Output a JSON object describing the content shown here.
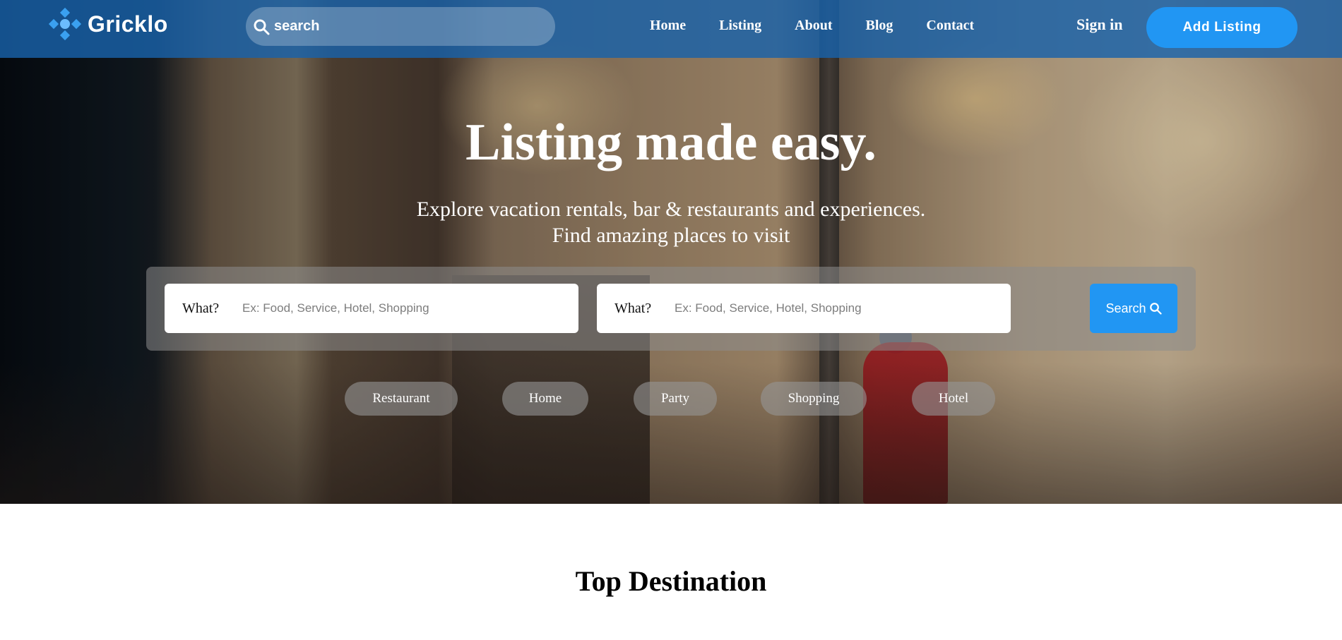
{
  "brand": {
    "name": "Gricklo",
    "accent": "#2196f3",
    "nav_bg": "#1862aa"
  },
  "nav": {
    "search_placeholder": "search",
    "links": [
      "Home",
      "Listing",
      "About",
      "Blog",
      "Contact"
    ],
    "sign_in": "Sign in",
    "add_listing": "Add Listing"
  },
  "hero": {
    "title": "Listing made easy.",
    "subtitle_line1": "Explore vacation rentals, bar & restaurants and experiences.",
    "subtitle_line2": "Find amazing places to visit",
    "search": {
      "field1_label": "What?",
      "field1_placeholder": "Ex: Food, Service, Hotel, Shopping",
      "field2_label": "What?",
      "field2_placeholder": "Ex: Food, Service, Hotel, Shopping",
      "button": "Search"
    },
    "categories": [
      "Restaurant",
      "Home",
      "Party",
      "Shopping",
      "Hotel"
    ]
  },
  "sections": {
    "top_destination": "Top Destination"
  },
  "icons": {
    "search": "search-icon",
    "logo": "gricklo-logo-icon"
  }
}
